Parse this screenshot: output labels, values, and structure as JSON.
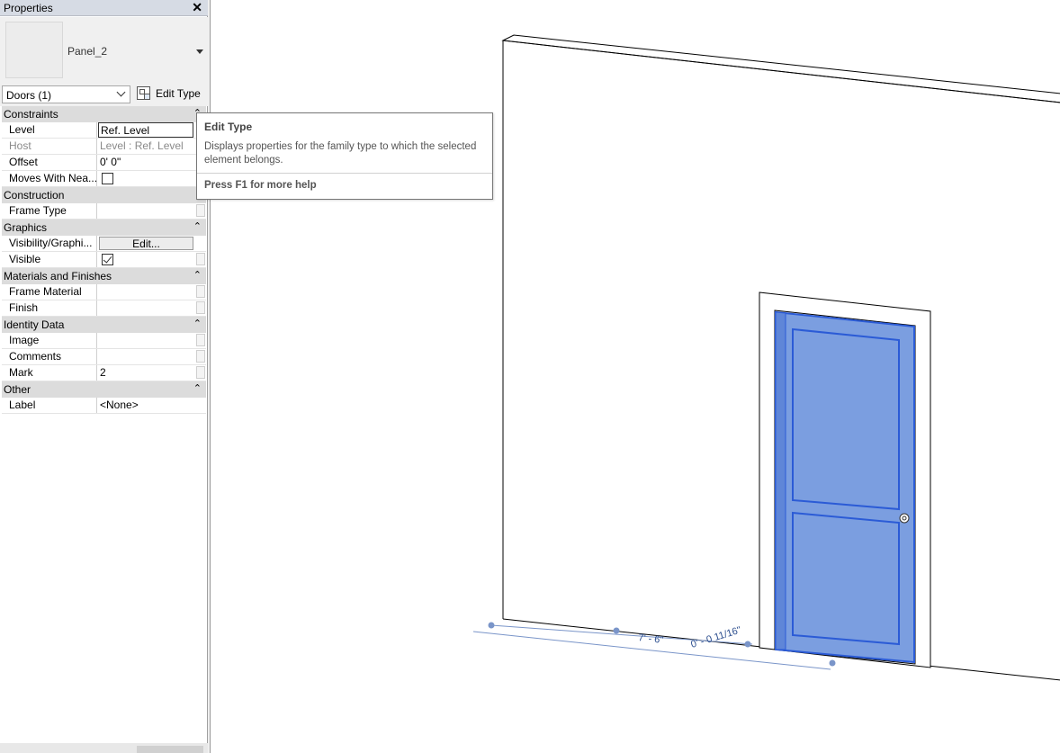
{
  "panel": {
    "title": "Properties",
    "close_glyph": "✕",
    "type_name": "Panel_2",
    "instance_selector": "Doors (1)",
    "edit_type_label": "Edit Type"
  },
  "groups": [
    {
      "label": "Constraints",
      "rows": [
        {
          "name": "Level",
          "value": "Ref. Level"
        },
        {
          "name": "Host",
          "value": "Level : Ref. Level"
        },
        {
          "name": "Offset",
          "value": "0'  0\""
        },
        {
          "name": "Moves With Nea...",
          "value": ""
        }
      ]
    },
    {
      "label": "Construction",
      "rows": [
        {
          "name": "Frame Type",
          "value": ""
        }
      ]
    },
    {
      "label": "Graphics",
      "rows": [
        {
          "name": "Visibility/Graphi...",
          "value": "Edit..."
        },
        {
          "name": "Visible",
          "value": ""
        }
      ]
    },
    {
      "label": "Materials and Finishes",
      "rows": [
        {
          "name": "Frame Material",
          "value": ""
        },
        {
          "name": "Finish",
          "value": ""
        }
      ]
    },
    {
      "label": "Identity Data",
      "rows": [
        {
          "name": "Image",
          "value": ""
        },
        {
          "name": "Comments",
          "value": ""
        },
        {
          "name": "Mark",
          "value": "2"
        }
      ]
    },
    {
      "label": "Other",
      "rows": [
        {
          "name": "Label",
          "value": "<None>"
        }
      ]
    }
  ],
  "group_collapse_glyph": "⌃",
  "checkboxes": {
    "moves_with_nearby": false,
    "visible": true
  },
  "tooltip": {
    "title": "Edit Type",
    "description": "Displays properties for the family type to which the selected element belongs.",
    "help": "Press F1 for more help"
  },
  "viewport": {
    "dim_width": "7' - 6\"",
    "dim_offset": "0' - 0 11/16\"",
    "door_color": "#7b9ee0",
    "door_edge_color": "#2b5bd6"
  }
}
